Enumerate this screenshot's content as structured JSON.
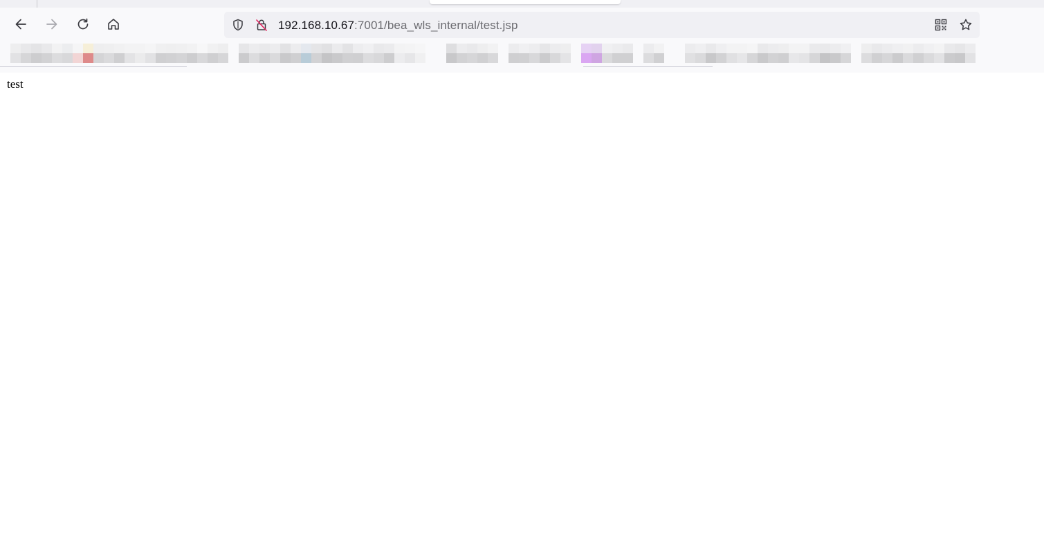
{
  "browser": {
    "url": {
      "host": "192.168.10.67",
      "rest": ":7001/bea_wls_internal/test.jsp"
    },
    "icons": {
      "back": "arrow-left-icon",
      "forward": "arrow-right-icon",
      "reload": "reload-icon",
      "home": "home-icon",
      "tracking": "shield-icon",
      "insecure": "insecure-lock-icon",
      "qr": "qr-code-icon",
      "bookmark": "star-icon"
    }
  },
  "page": {
    "body_text": "test"
  }
}
